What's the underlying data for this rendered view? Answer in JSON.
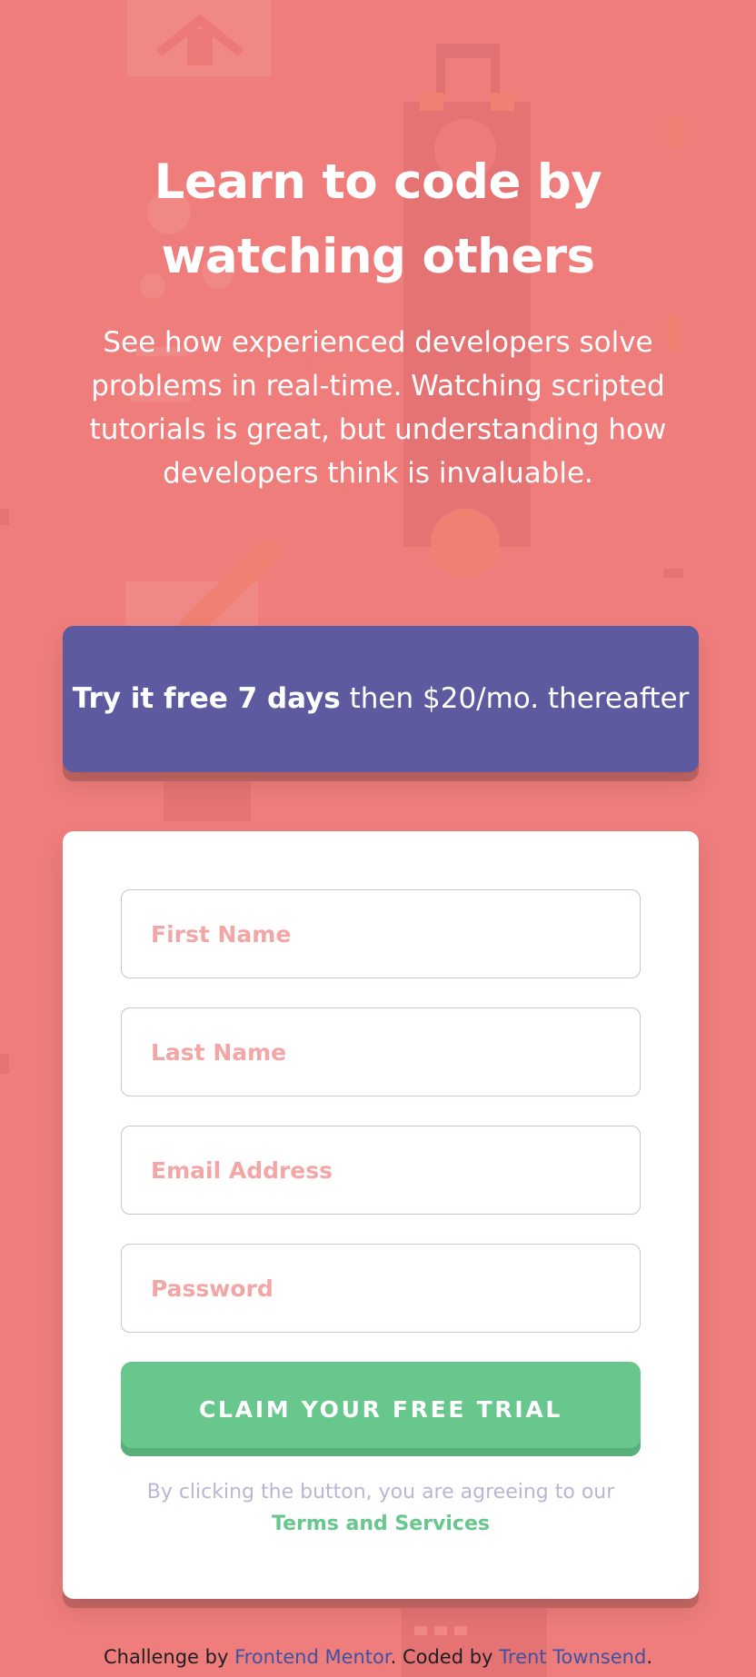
{
  "hero": {
    "title": "Learn to code by watching others",
    "description": "See how experienced developers solve problems in real-time. Watching scripted tutorials is great, but understanding how developers think is invaluable."
  },
  "promo": {
    "bold_text": "Try it free 7 days",
    "text_after_bold": " then $20/mo. thereafter"
  },
  "form": {
    "first_name_placeholder": "First Name",
    "last_name_placeholder": "Last Name",
    "email_placeholder": "Email Address",
    "password_placeholder": "Password",
    "submit_label": "CLAIM YOUR FREE TRIAL",
    "terms_prefix": "By clicking the button, you are agreeing to our ",
    "terms_link": "Terms and Services"
  },
  "footer": {
    "challenge_by": "Challenge by ",
    "frontend_mentor": "Frontend Mentor",
    "coded_by": ". Coded by ",
    "author": "Trent Townsend",
    "suffix": "."
  },
  "colors": {
    "background": "#ef7d7b",
    "promo": "#5e5a9f",
    "cta": "#68c78d",
    "placeholder": "#f3a6a6",
    "link": "#3e52a3"
  }
}
